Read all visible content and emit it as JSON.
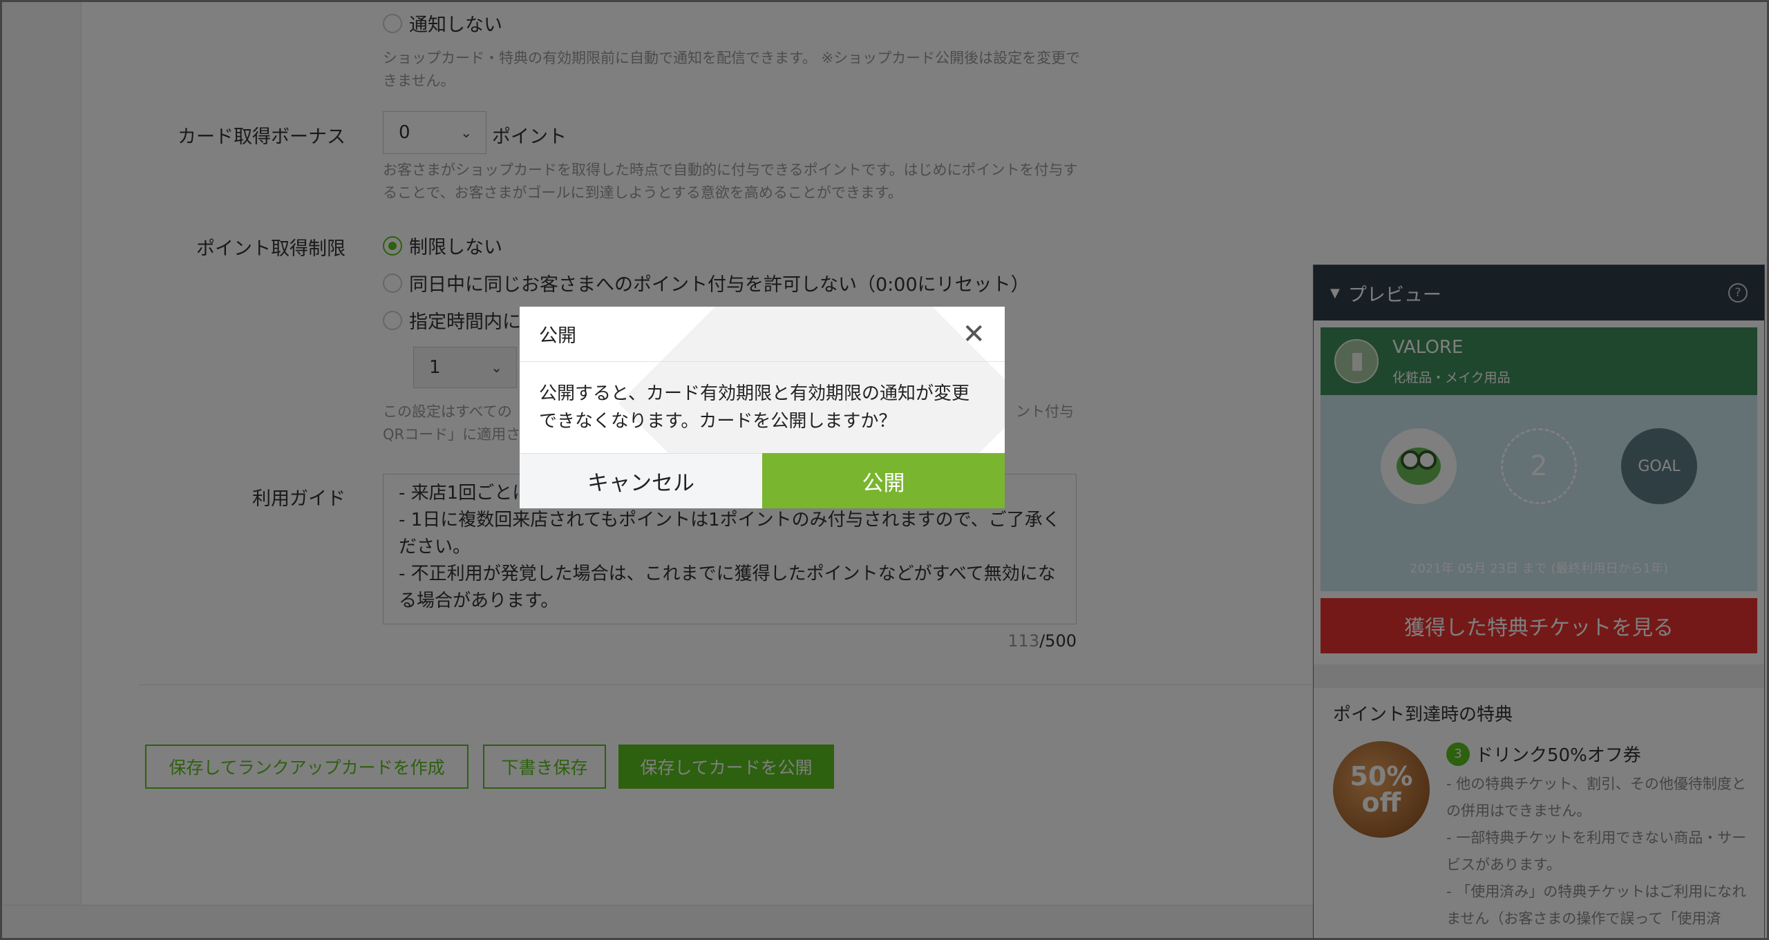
{
  "form": {
    "notify_none": "通知しない",
    "notify_help": "ショップカード・特典の有効期限前に自動で通知を配信できます。 ※ショップカード公開後は設定を変更できません。",
    "bonus_label": "カード取得ボーナス",
    "bonus_value": "0",
    "bonus_unit": "ポイント",
    "bonus_help": "お客さまがショップカードを取得した時点で自動的に付与できるポイントです。はじめにポイントを付与することで、お客さまがゴールに到達しようとする意欲を高めることができます。",
    "limit_label": "ポイント取得制限",
    "limit_options": [
      "制限しない",
      "同日中に同じお客さまへのポイント付与を許可しない（0:00にリセット）",
      "指定時間内に"
    ],
    "limit_select": "1",
    "limit_help_line1": "この設定はすべての",
    "limit_help_line1_tail": "ント付与",
    "limit_help_line2": "QRコード」に適用さ",
    "guide_label": "利用ガイド",
    "guide_lines": [
      "- 来店1回ごとに",
      "- 1日に複数回来店されてもポイントは1ポイントのみ付与されますので、ご了承ください。",
      "- 不正利用が発覚した場合は、これまでに獲得したポイントなどがすべて無効になる場合があります。"
    ],
    "guide_count": "113",
    "guide_max": "/500"
  },
  "actions": {
    "rankup": "保存してランクアップカードを作成",
    "draft": "下書き保存",
    "publish": "保存してカードを公開"
  },
  "preview": {
    "title": "プレビュー",
    "help": "?",
    "shop_name": "VALORE",
    "shop_category": "化粧品・メイク用品",
    "stamp_next": "2",
    "stamp_goal": "GOAL",
    "expiry": "2021年 05月 23日 まで (最終利用日から1年)",
    "ticket_button": "獲得した特典チケットを見る",
    "reward_section": "ポイント到達時の特典",
    "reward_badge": "3",
    "reward_name": "ドリンク50%オフ券",
    "reward_img_line1": "50%",
    "reward_img_line2": "off",
    "reward_desc": [
      "- 他の特典チケット、割引、その他優待制度との併用はできません。",
      "- 一部特典チケットを利用できない商品・サービスがあります。",
      "- 「使用済み」の特典チケットはご利用になれません（お客さまの操作で誤って「使用済"
    ]
  },
  "modal": {
    "title": "公開",
    "message": "公開すると、カード有効期限と有効期限の通知が変更できなくなります。カードを公開しますか？",
    "cancel": "キャンセル",
    "confirm": "公開"
  },
  "colors": {
    "accent": "#5ac01e",
    "confirm": "#7ab52f",
    "ticket": "#e8332f",
    "preview_header": "#2f3d48"
  }
}
